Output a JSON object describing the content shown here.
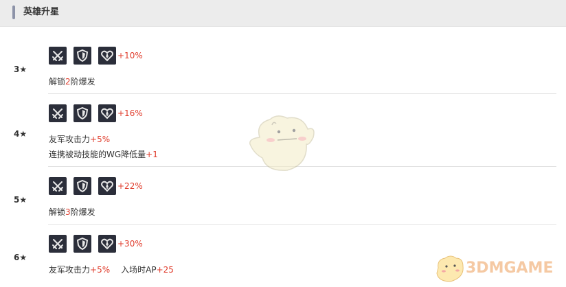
{
  "header": {
    "title": "英雄升星"
  },
  "icon_names": [
    "crossed-swords-icon",
    "shield-icon",
    "heart-icon"
  ],
  "rows": [
    {
      "star": "3★",
      "bonus": "+10%",
      "lines": [
        {
          "a": "解锁",
          "b": "2",
          "c": "阶爆发"
        }
      ]
    },
    {
      "star": "4★",
      "bonus": "+16%",
      "lines": [
        {
          "a": "友军攻击力",
          "b": "+5%"
        },
        {
          "a": "连携被动技能的WG降低量",
          "b": "+1"
        }
      ]
    },
    {
      "star": "5★",
      "bonus": "+22%",
      "lines": [
        {
          "a": "解锁",
          "b": "3",
          "c": "阶爆发"
        }
      ]
    },
    {
      "star": "6★",
      "bonus": "+30%",
      "lines": [
        {
          "a": "友军攻击力",
          "b": "+5%",
          "c2": "入场时AP",
          "d": "+25"
        }
      ]
    }
  ],
  "watermark": {
    "text": "3DMGAME"
  },
  "colors": {
    "accent": "#e03c2c",
    "icon_bg": "#2b2e3a",
    "header_bg": "#ececec"
  }
}
